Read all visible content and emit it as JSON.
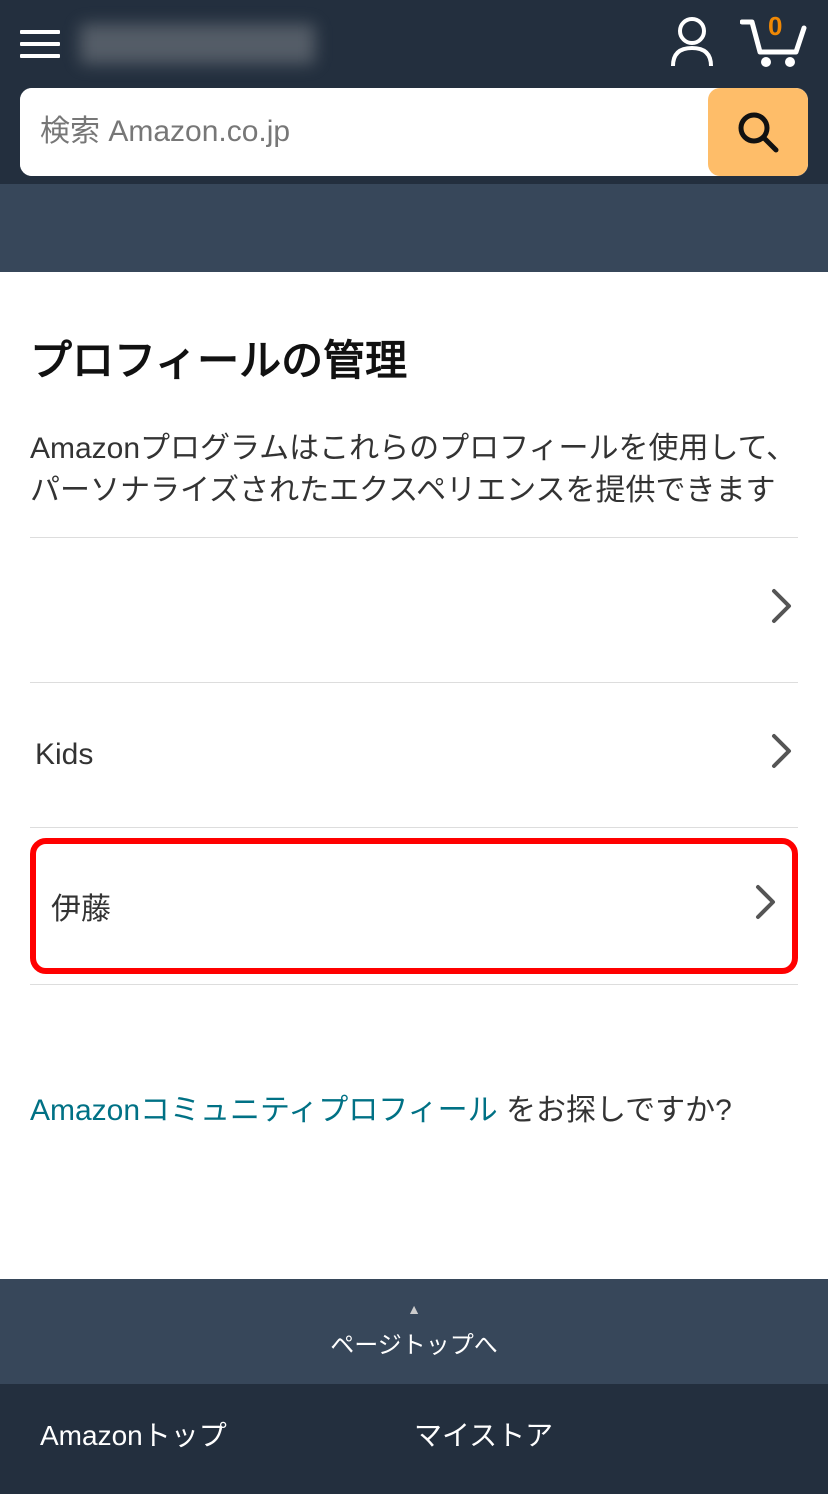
{
  "header": {
    "cart_count": "0",
    "search_placeholder": "検索 Amazon.co.jp"
  },
  "page": {
    "title": "プロフィールの管理",
    "description": "Amazonプログラムはこれらのプロフィールを使用して、パーソナライズされたエクスペリエンスを提供できます"
  },
  "profiles": [
    {
      "name": "",
      "highlighted": false
    },
    {
      "name": "Kids",
      "highlighted": false
    },
    {
      "name": "伊藤",
      "highlighted": true
    }
  ],
  "community": {
    "link_text": "Amazonコミュニティプロフィール",
    "after_text": " をお探しですか?"
  },
  "footer": {
    "top_text": "ページトップへ",
    "links": {
      "amazon_top": "Amazonトップ",
      "my_store": "マイストア"
    }
  }
}
